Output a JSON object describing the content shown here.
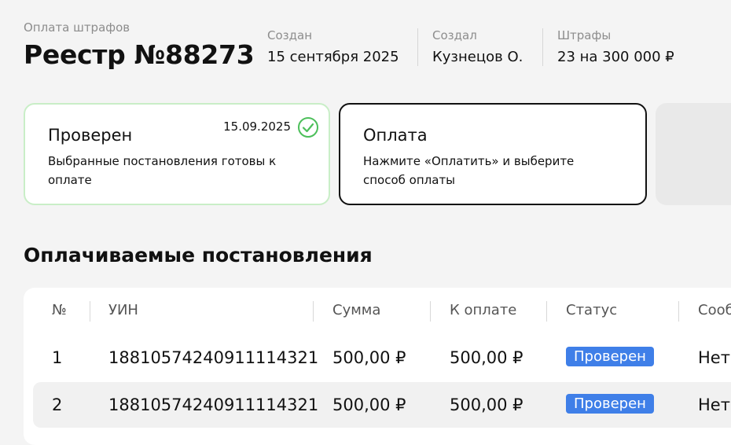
{
  "header": {
    "breadcrumb": "Оплата штрафов",
    "title": "Реестр №88273",
    "meta": [
      {
        "label": "Создан",
        "value": "15 сентября 2025"
      },
      {
        "label": "Создал",
        "value": "Кузнецов О."
      },
      {
        "label": "Штрафы",
        "value": "23 на 300 000 ₽"
      }
    ]
  },
  "steps": [
    {
      "title": "Проверен",
      "text": "Выбранные постановления готовы к оплате",
      "date": "15.09.2025",
      "status": "done",
      "icon": "check-circle-icon"
    },
    {
      "title": "Оплата",
      "text": "Нажмите «Оплатить» и выберите способ оплаты",
      "status": "active"
    }
  ],
  "section_title": "Оплачиваемые постановления",
  "table": {
    "columns": [
      "№",
      "УИН",
      "Сумма",
      "К оплате",
      "Статус",
      "Сооб"
    ],
    "rows": [
      {
        "num": "1",
        "uin": "18810574240911114321",
        "sum": "500,00 ₽",
        "to_pay": "500,00 ₽",
        "status": "Проверен",
        "message": "Нет"
      },
      {
        "num": "2",
        "uin": "18810574240911114321",
        "sum": "500,00 ₽",
        "to_pay": "500,00 ₽",
        "status": "Проверен",
        "message": "Нет"
      }
    ]
  },
  "colors": {
    "accent_green": "#4cbf5a",
    "badge_blue": "#3f7fe8"
  }
}
